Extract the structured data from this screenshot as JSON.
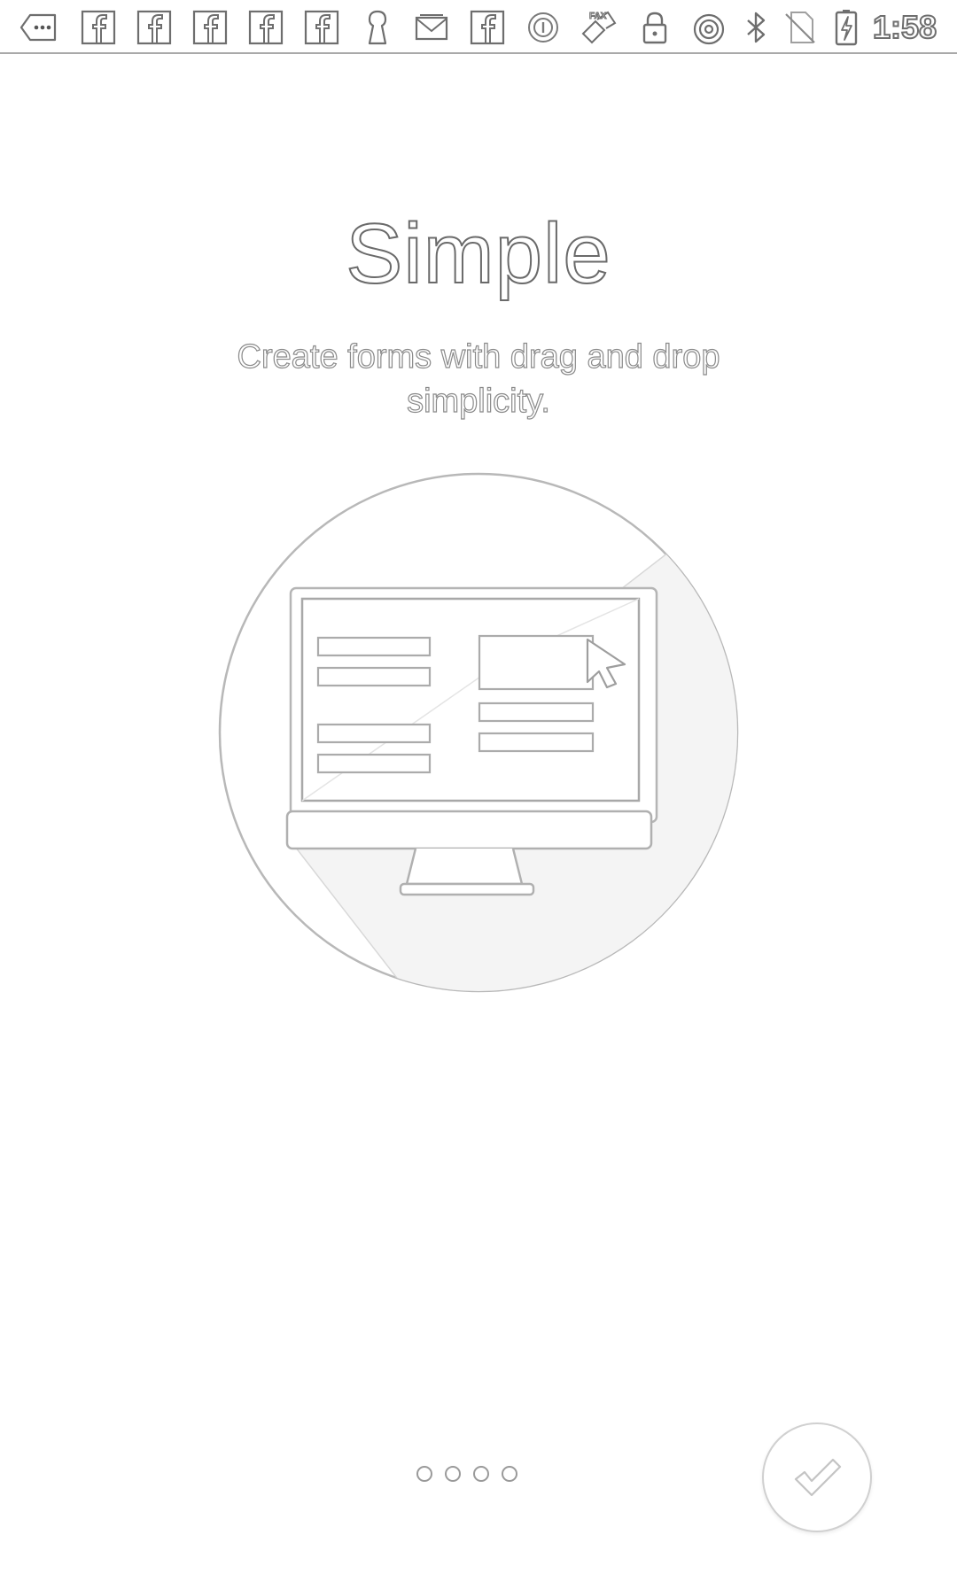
{
  "status_bar": {
    "icons": [
      "more-notifications-icon",
      "facebook-icon",
      "facebook-icon",
      "facebook-icon",
      "facebook-icon",
      "facebook-icon",
      "keyhole-icon",
      "email-icon",
      "facebook-icon",
      "circle-app-icon",
      "fax-icon",
      "lock-icon",
      "hotspot-icon",
      "bluetooth-icon",
      "no-sim-icon",
      "battery-charging-icon"
    ],
    "time": "1:58"
  },
  "onboarding": {
    "title": "Simple",
    "subtitle": "Create forms with drag and drop simplicity.",
    "illustration": "monitor-form-builder-icon"
  },
  "pager": {
    "total_pages": 4,
    "current_page": 1
  },
  "done_button": {
    "icon": "checkmark-icon"
  }
}
